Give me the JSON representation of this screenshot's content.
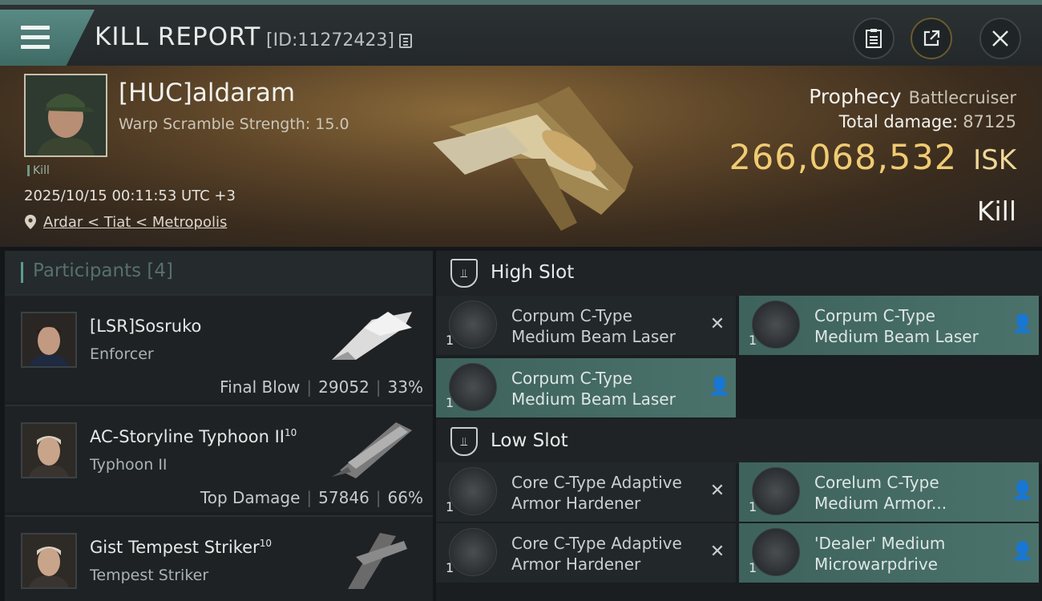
{
  "header": {
    "title": "KILL REPORT",
    "kill_id": "[ID:11272423]"
  },
  "victim": {
    "name": "[HUC]aldaram",
    "warp_scramble": "Warp Scramble Strength: 15.0",
    "tag": "Kill",
    "timestamp": "2025/10/15 00:11:53 UTC +3",
    "location": "Ardar < Tiat < Metropolis",
    "ship_name": "Prophecy",
    "ship_class": "Battlecruiser",
    "total_damage_label": "Total damage:",
    "total_damage": "87125",
    "isk_value": "266,068,532",
    "isk_unit": "ISK",
    "result": "Kill"
  },
  "participants": {
    "label": "Participants [4]",
    "items": [
      {
        "name": "[LSR]Sosruko",
        "level": "",
        "ship": "Enforcer",
        "stat_label": "Final Blow",
        "damage": "29052",
        "percent": "33%"
      },
      {
        "name": "AC-Storyline Typhoon II",
        "level": "10",
        "ship": "Typhoon II",
        "stat_label": "Top Damage",
        "damage": "57846",
        "percent": "66%"
      },
      {
        "name": "Gist Tempest Striker",
        "level": "10",
        "ship": "Tempest Striker",
        "stat_label": "",
        "damage": "",
        "percent": ""
      }
    ]
  },
  "slots": {
    "high_label": "High Slot",
    "low_label": "Low Slot",
    "high": [
      {
        "line1": "Corpum C-Type",
        "line2": "Medium Beam Laser",
        "qty": "1",
        "status": "destroyed",
        "icon": "beam-laser-icon"
      },
      {
        "line1": "Corpum C-Type",
        "line2": "Medium Beam Laser",
        "qty": "1",
        "status": "dropped",
        "icon": "beam-laser-icon"
      },
      {
        "line1": "Corpum C-Type",
        "line2": "Medium Beam Laser",
        "qty": "1",
        "status": "dropped",
        "icon": "beam-laser-icon"
      }
    ],
    "low": [
      {
        "line1": "Core C-Type Adaptive",
        "line2": "Armor Hardener",
        "qty": "1",
        "status": "destroyed",
        "icon": "armor-hardener-icon"
      },
      {
        "line1": "Corelum C-Type",
        "line2": "Medium Armor...",
        "qty": "1",
        "status": "dropped",
        "icon": "armor-repairer-icon"
      },
      {
        "line1": "Core C-Type Adaptive",
        "line2": "Armor Hardener",
        "qty": "1",
        "status": "destroyed",
        "icon": "armor-hardener-icon"
      },
      {
        "line1": "'Dealer' Medium",
        "line2": "Microwarpdrive",
        "qty": "1",
        "status": "dropped",
        "icon": "microwarpdrive-icon"
      }
    ]
  },
  "colors": {
    "accent": "#4a726b",
    "isk": "#f0cb72"
  }
}
